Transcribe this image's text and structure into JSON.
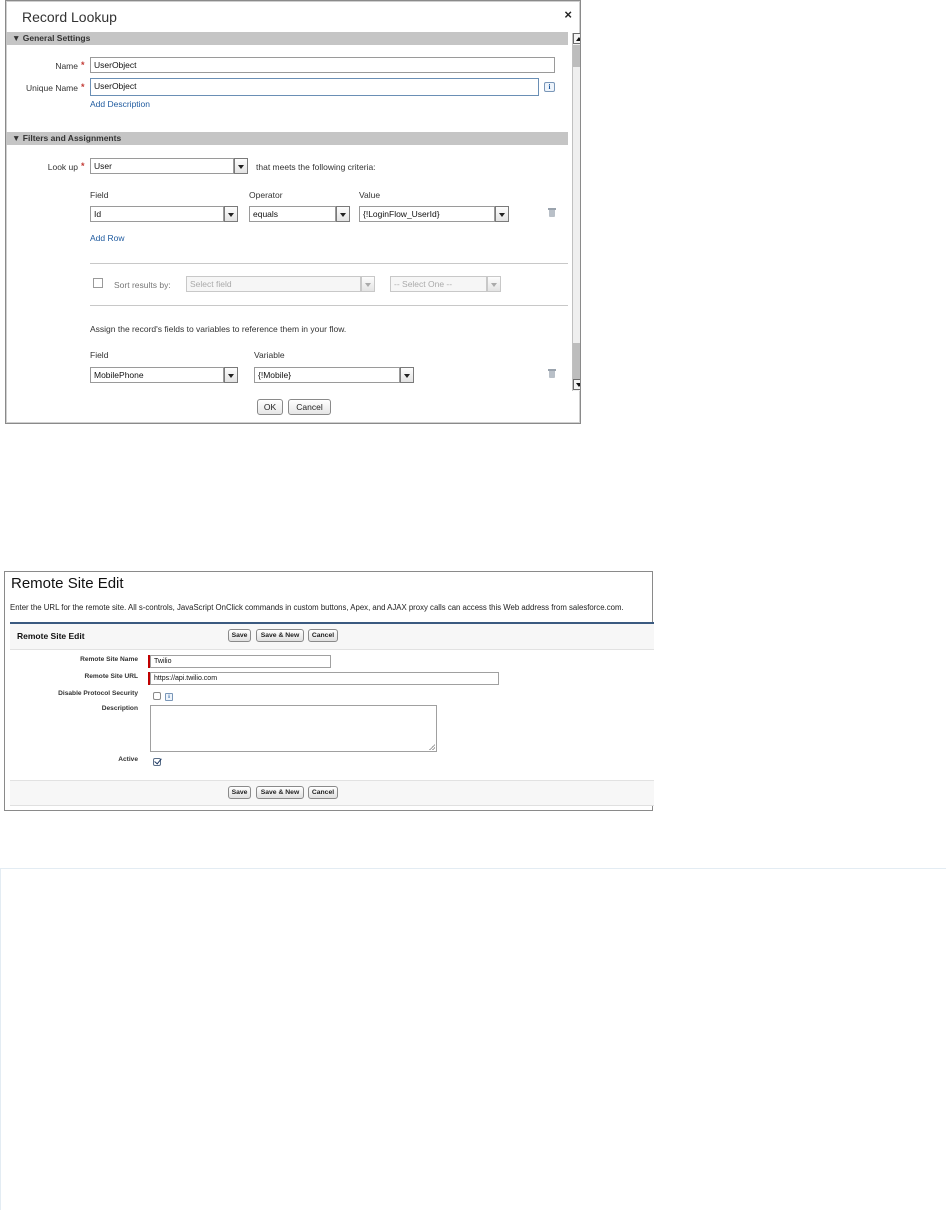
{
  "record_lookup": {
    "title": "Record Lookup",
    "close_symbol": "×",
    "general_settings": {
      "header": "General Settings",
      "name_label": "Name",
      "name_value": "UserObject",
      "unique_name_label": "Unique Name",
      "unique_name_value": "UserObject",
      "add_description": "Add Description",
      "required_mark": "*",
      "info_symbol": "i"
    },
    "filters": {
      "header": "Filters and Assignments",
      "lookup_label": "Look up",
      "lookup_value": "User",
      "criteria_text": "that meets the following criteria:",
      "field_header": "Field",
      "operator_header": "Operator",
      "value_header": "Value",
      "row_field": "Id",
      "row_operator": "equals",
      "row_value": "{!LoginFlow_UserId}",
      "add_row": "Add Row",
      "sort_label": "Sort results by:",
      "sort_field_placeholder": "Select field",
      "sort_order_placeholder": "-- Select One --",
      "assign_text": "Assign the record's fields to variables to reference them in your flow.",
      "assign_field_header": "Field",
      "assign_variable_header": "Variable",
      "assign_field": "MobilePhone",
      "assign_variable": "{!Mobile}"
    },
    "buttons": {
      "ok": "OK",
      "cancel": "Cancel"
    }
  },
  "remote_site": {
    "title": "Remote Site Edit",
    "description": "Enter the URL for the remote site. All s-controls, JavaScript OnClick commands in custom buttons, Apex, and AJAX proxy calls can access this Web address from salesforce.com.",
    "section_title": "Remote Site Edit",
    "buttons": {
      "save": "Save",
      "save_new": "Save & New",
      "cancel": "Cancel"
    },
    "fields": {
      "name_label": "Remote Site Name",
      "name_value": "Twilio",
      "url_label": "Remote Site URL",
      "url_value": "https://api.twilio.com",
      "disable_label": "Disable Protocol Security",
      "description_label": "Description",
      "active_label": "Active",
      "info_symbol": "i"
    },
    "state": {
      "disable_protocol_security": false,
      "active": true
    }
  }
}
